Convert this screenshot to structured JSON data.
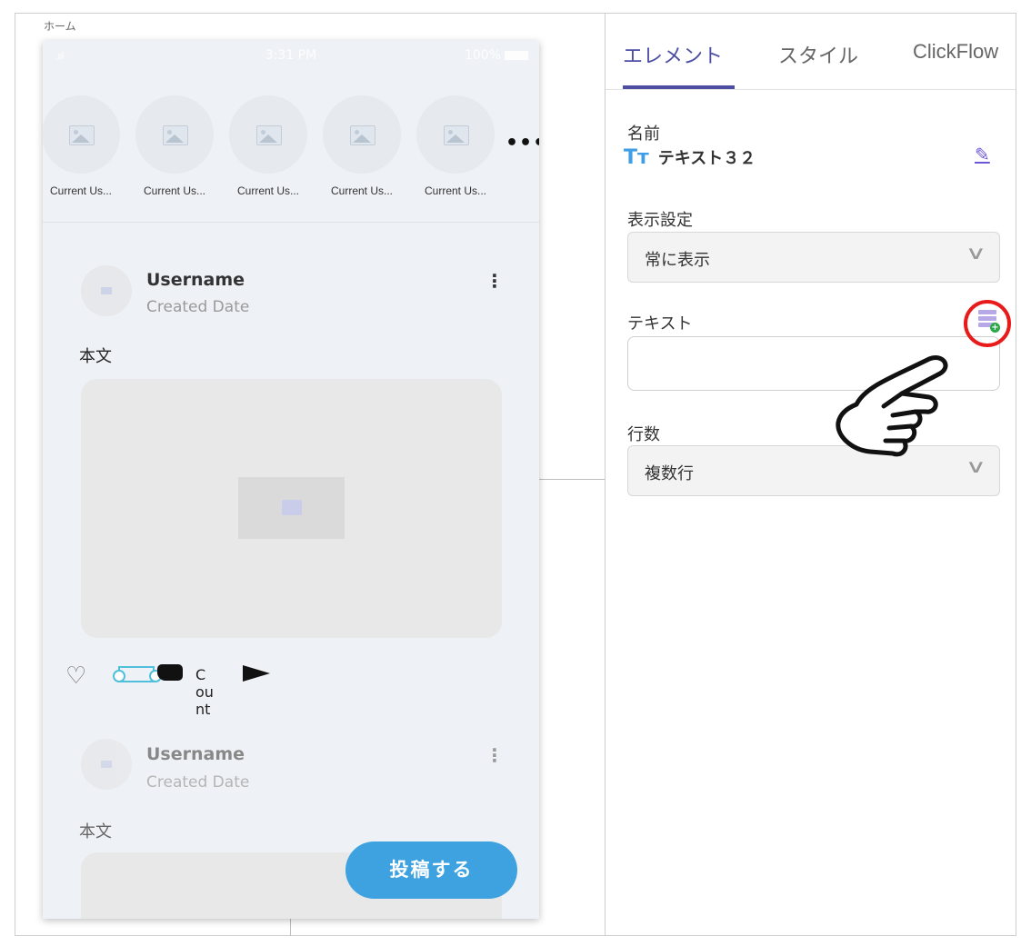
{
  "canvas": {
    "screen_label": "ホーム"
  },
  "phone": {
    "status": {
      "signal": ".ııl",
      "time": "3:31 PM",
      "battery": "100%"
    },
    "stories": {
      "items": [
        {
          "name": "Current Us..."
        },
        {
          "name": "Current Us..."
        },
        {
          "name": "Current Us..."
        },
        {
          "name": "Current Us..."
        },
        {
          "name": "Current Us..."
        }
      ],
      "more": "•••"
    },
    "posts": [
      {
        "username": "Username",
        "date": "Created Date",
        "body": "本文",
        "menu": "⋮"
      },
      {
        "username": "Username",
        "date": "Created Date",
        "body": "本文",
        "menu": "⋮"
      }
    ],
    "actions": {
      "heart": "♡",
      "count": "Count"
    },
    "fab_label": "投稿する"
  },
  "panel": {
    "tabs": [
      {
        "label": "エレメント",
        "active": true
      },
      {
        "label": "スタイル",
        "active": false
      },
      {
        "label": "ClickFlow",
        "active": false
      }
    ],
    "name_label": "名前",
    "tt_icon": "Tт",
    "element_name": "テキスト３２",
    "pencil": "✎",
    "visibility": {
      "label": "表示設定",
      "value": "常に表示",
      "chevron": "∨"
    },
    "text": {
      "label": "テキスト",
      "value": ""
    },
    "lines": {
      "label": "行数",
      "value": "複数行",
      "chevron": "∨"
    }
  },
  "colors": {
    "accent": "#4d4ea3",
    "fab": "#3ea2e0",
    "highlight_circle": "#e81a1a",
    "selection": "#4fbfdc"
  }
}
